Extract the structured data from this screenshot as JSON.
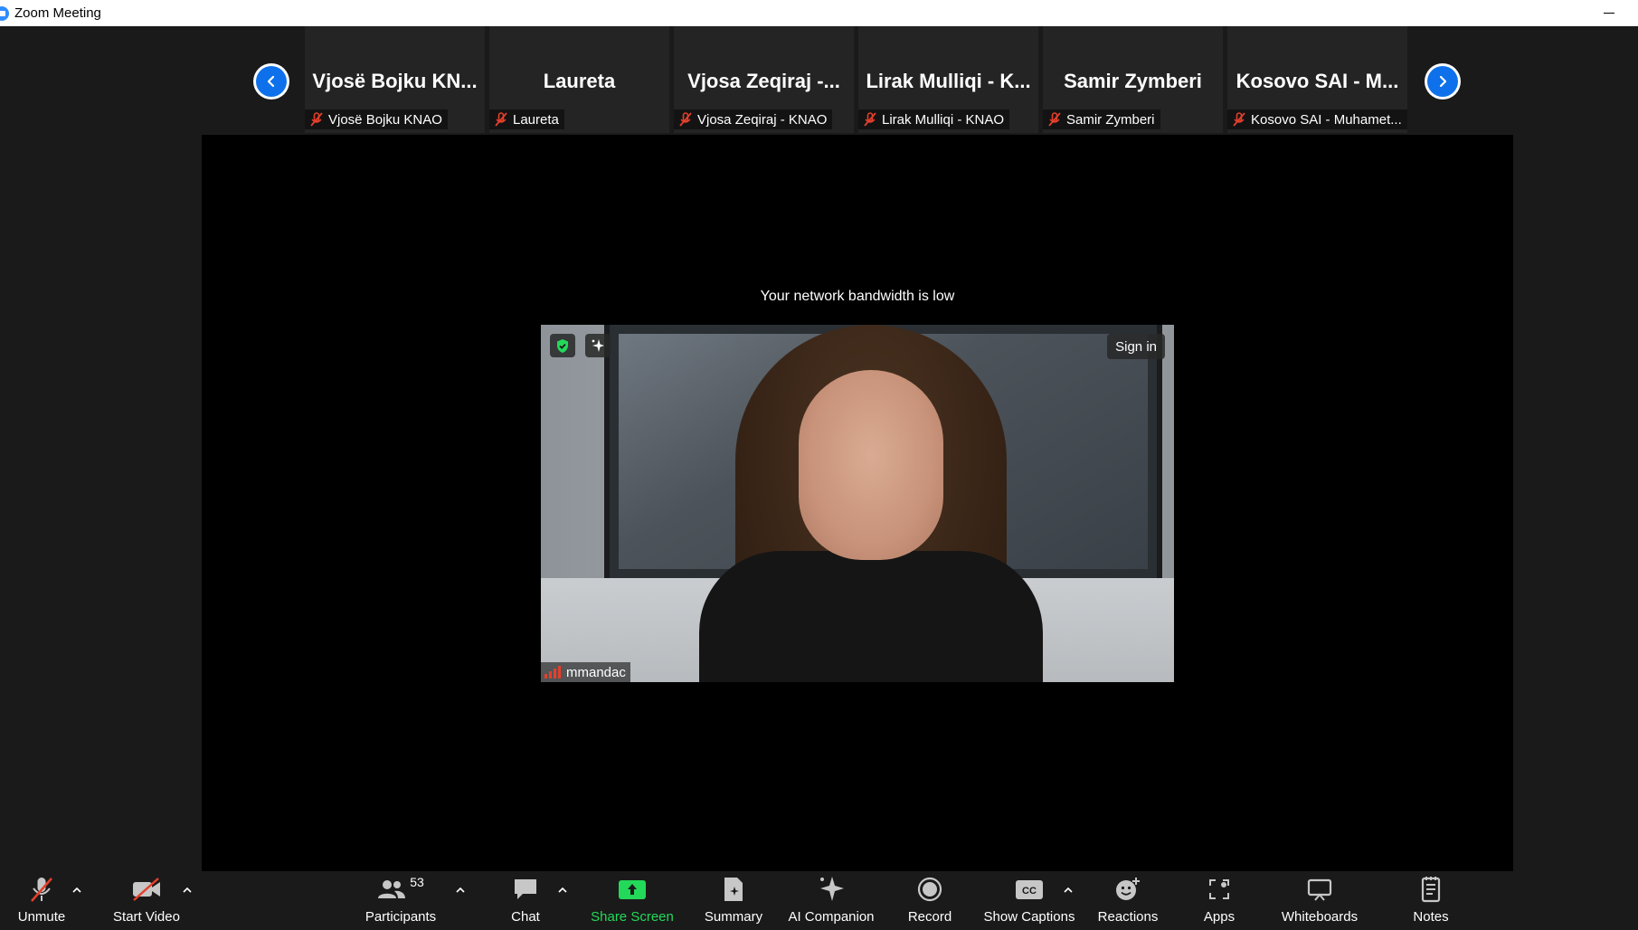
{
  "window": {
    "title": "Zoom Meeting"
  },
  "gallery": {
    "tiles": [
      {
        "name": "Vjosë Bojku KN...",
        "label": "Vjosë Bojku KNAO"
      },
      {
        "name": "Laureta",
        "label": "Laureta"
      },
      {
        "name": "Vjosa Zeqiraj -...",
        "label": "Vjosa Zeqiraj - KNAO"
      },
      {
        "name": "Lirak Mulliqi - K...",
        "label": "Lirak Mulliqi - KNAO"
      },
      {
        "name": "Samir Zymberi",
        "label": "Samir Zymberi"
      },
      {
        "name": "Kosovo SAI - M...",
        "label": "Kosovo SAI - Muhamet..."
      }
    ]
  },
  "stage": {
    "bandwidth_notice": "Your network bandwidth is low",
    "speaker_name": "mmandac",
    "sign_in_label": "Sign in"
  },
  "toolbar": {
    "unmute": "Unmute",
    "start_video": "Start Video",
    "participants": "Participants",
    "participants_count": "53",
    "chat": "Chat",
    "share_screen": "Share Screen",
    "summary": "Summary",
    "ai_companion": "AI Companion",
    "record": "Record",
    "show_captions": "Show Captions",
    "reactions": "Reactions",
    "apps": "Apps",
    "whiteboards": "Whiteboards",
    "notes": "Notes"
  },
  "colors": {
    "accent_blue": "#0e71eb",
    "share_green": "#23d959",
    "muted_red": "#e5402b",
    "background": "#1a1a1a"
  }
}
